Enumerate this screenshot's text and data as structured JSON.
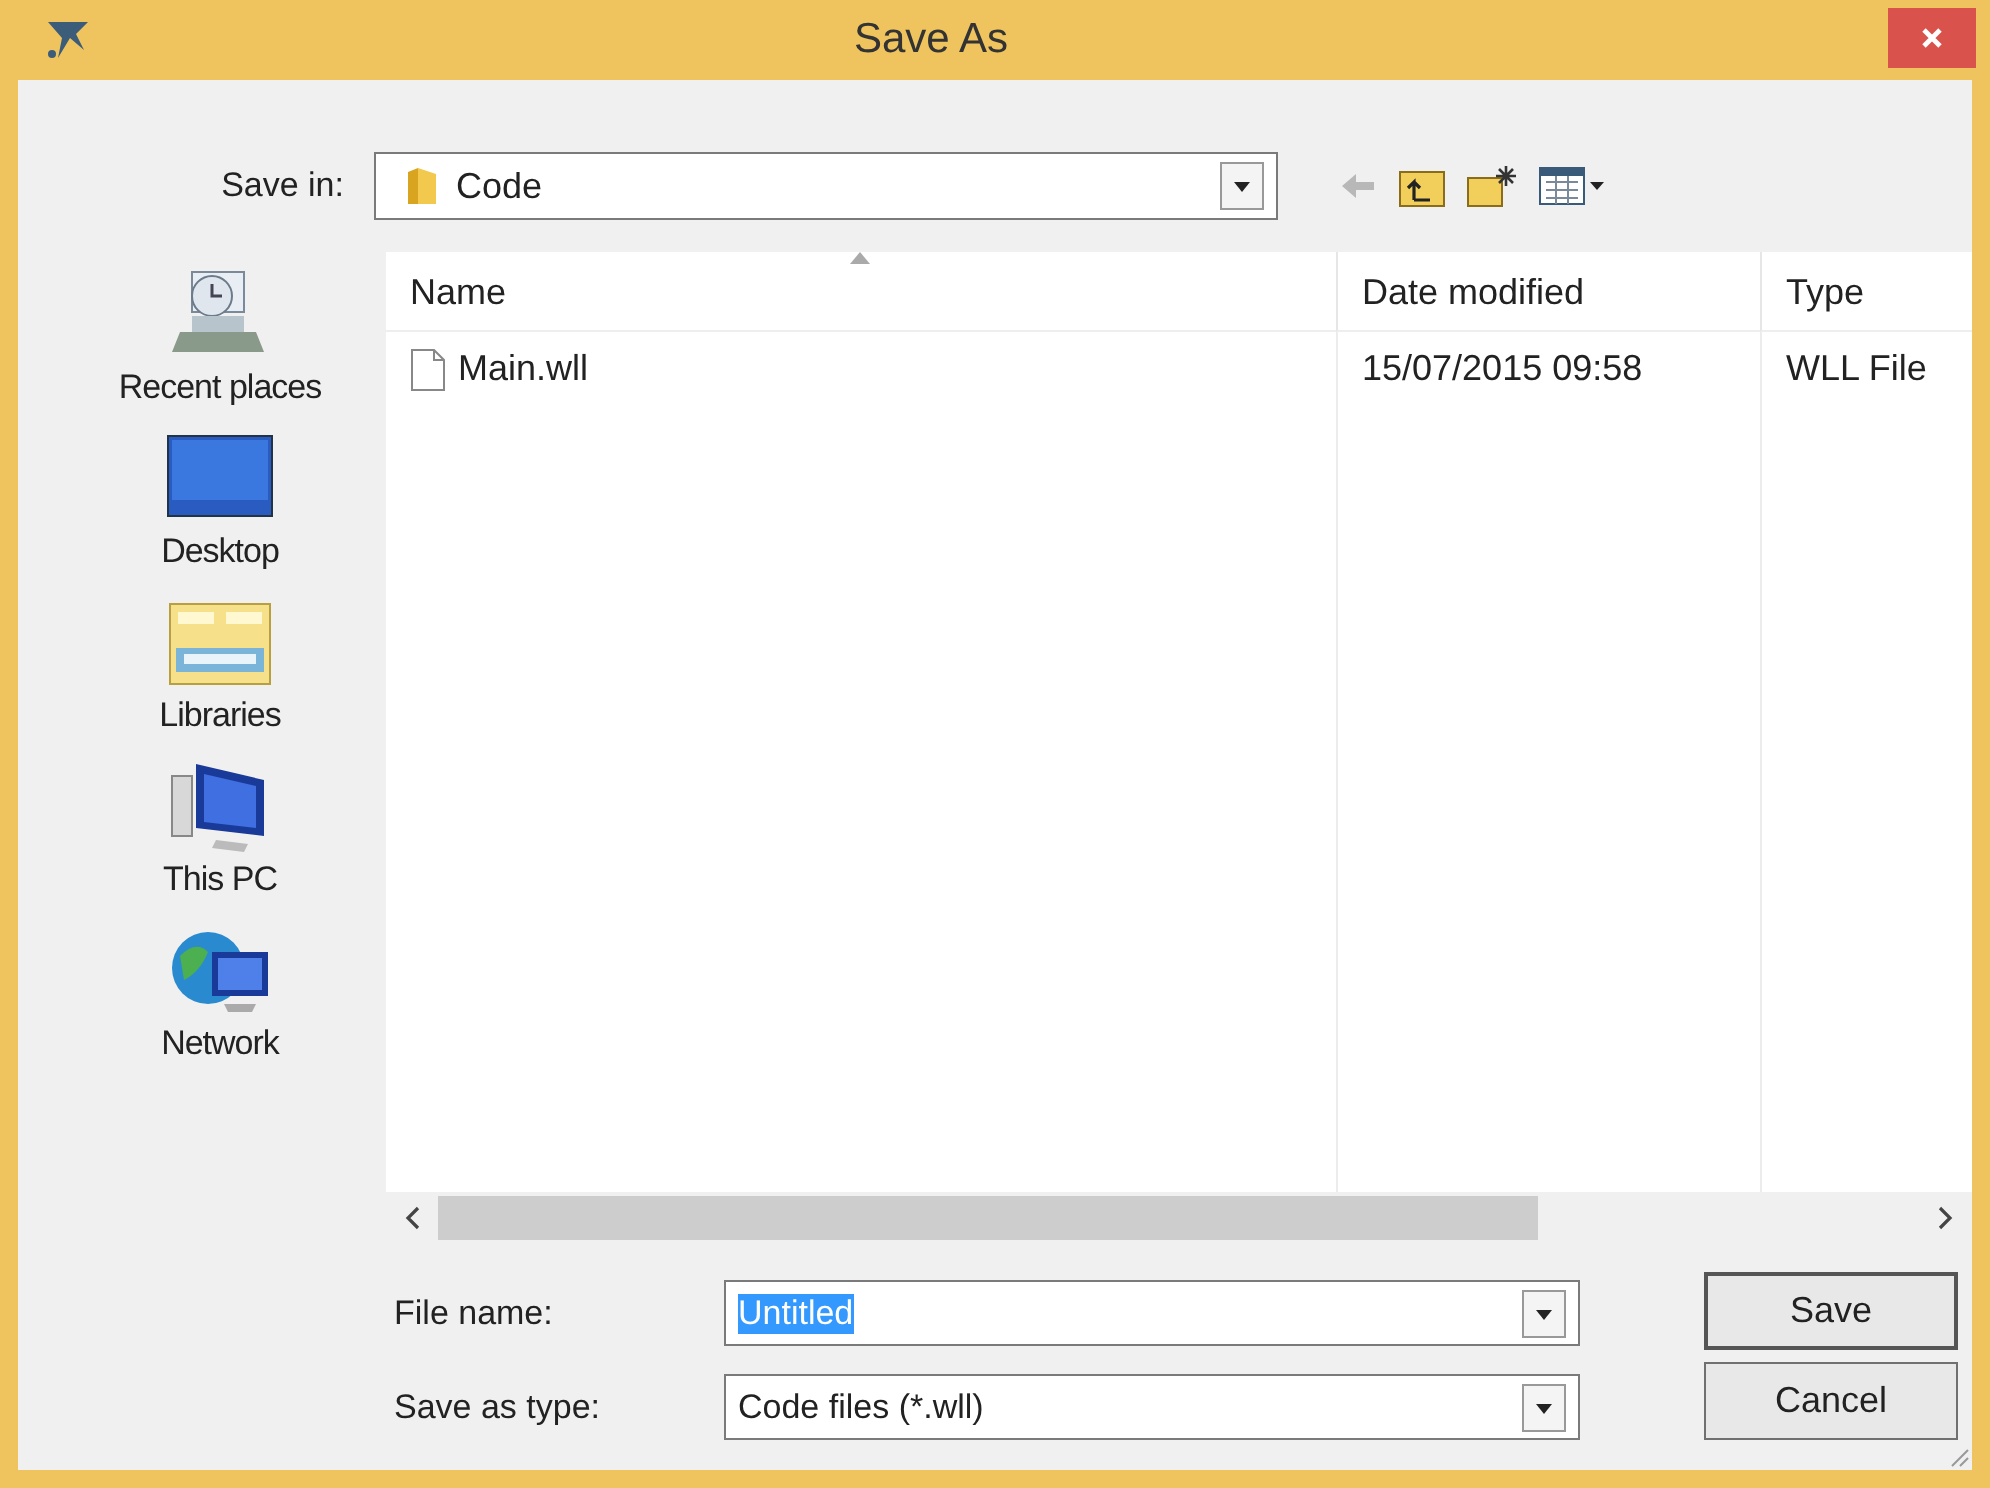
{
  "window": {
    "title": "Save As"
  },
  "save_in": {
    "label": "Save in:",
    "value": "Code"
  },
  "sidebar": {
    "items": [
      {
        "label": "Recent places",
        "kind": "recent"
      },
      {
        "label": "Desktop",
        "kind": "desktop"
      },
      {
        "label": "Libraries",
        "kind": "libraries"
      },
      {
        "label": "This PC",
        "kind": "pc"
      },
      {
        "label": "Network",
        "kind": "network"
      }
    ]
  },
  "file_list": {
    "columns": [
      "Name",
      "Date modified",
      "Type"
    ],
    "rows": [
      {
        "name": "Main.wll",
        "date": "15/07/2015 09:58",
        "type": "WLL File",
        "selected": false
      }
    ]
  },
  "file_name": {
    "label": "File name:",
    "value": "Untitled",
    "text_selected": true
  },
  "save_as_type": {
    "label": "Save as type:",
    "value": "Code files (*.wll)"
  },
  "buttons": [
    "Save",
    "Cancel"
  ]
}
